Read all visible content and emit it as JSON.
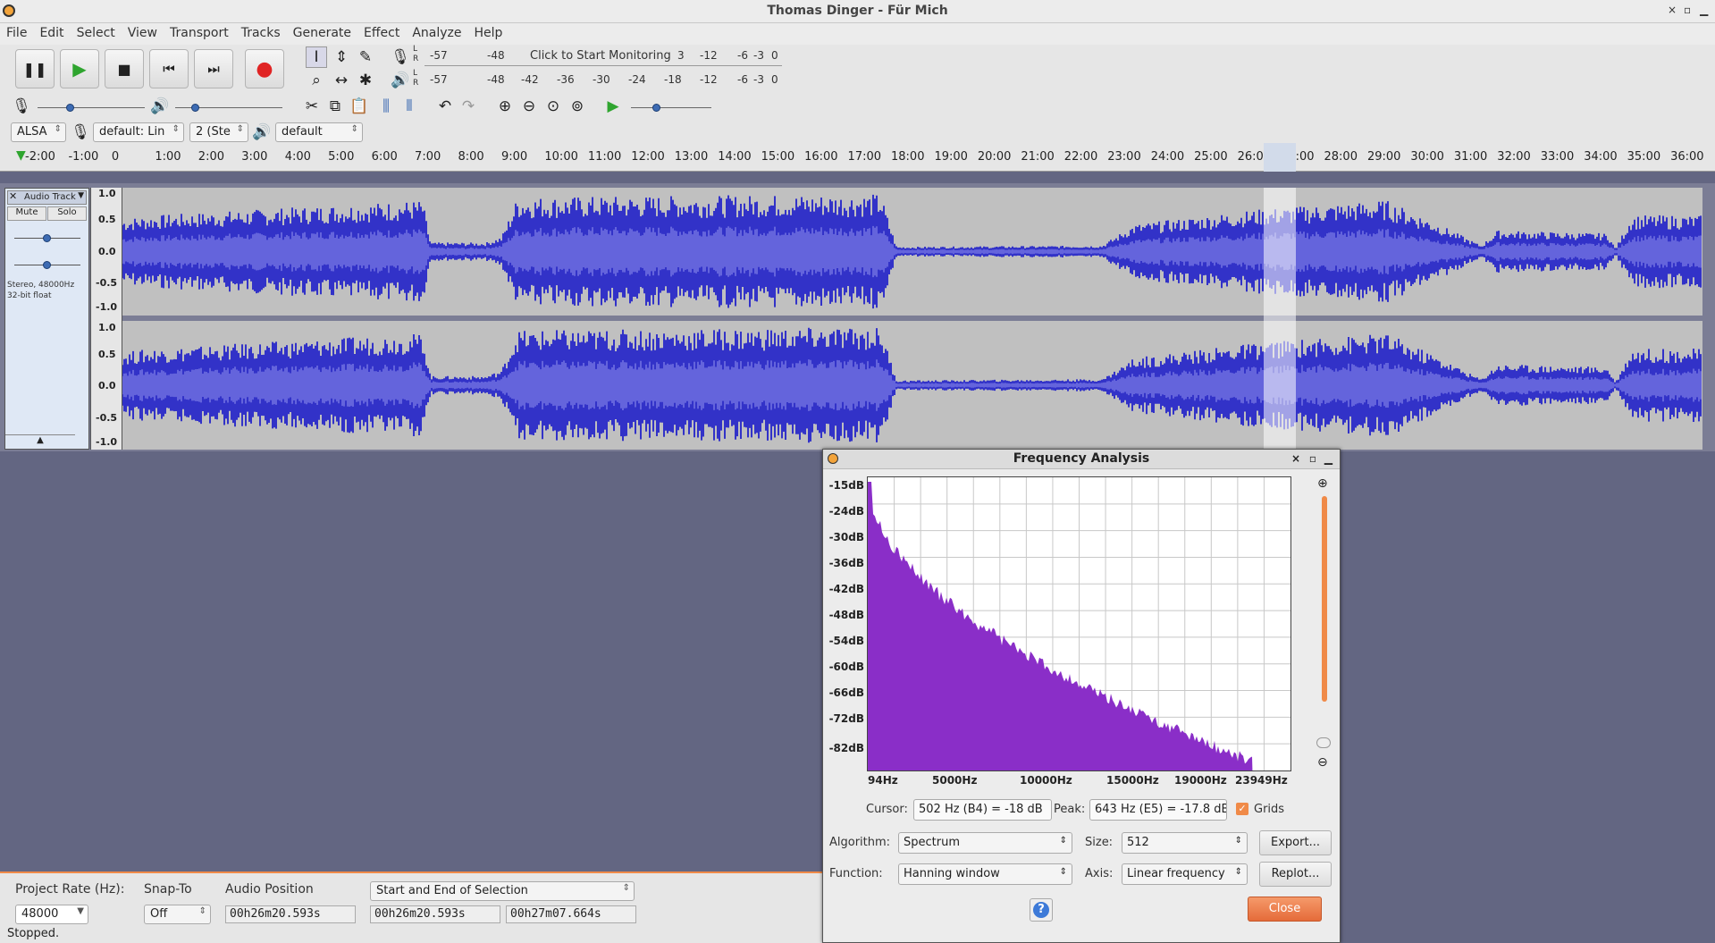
{
  "window": {
    "title": "Thomas Dinger - Für Mich"
  },
  "menu": [
    "File",
    "Edit",
    "Select",
    "View",
    "Transport",
    "Tracks",
    "Generate",
    "Effect",
    "Analyze",
    "Help"
  ],
  "meters": {
    "record_label": "L\nR",
    "record_scale": [
      "-57",
      "-48"
    ],
    "record_prompt": "Click to Start Monitoring",
    "record_scale_right": [
      "3",
      "-12",
      "-6",
      "-3",
      "0"
    ],
    "play_scale": [
      "-57",
      "-48",
      "-42",
      "-36",
      "-30",
      "-24",
      "-18",
      "-12",
      "-6",
      "-3",
      "0"
    ]
  },
  "device": {
    "host": "ALSA",
    "input": "default: Lin",
    "channels": "2 (Ste",
    "output": "default"
  },
  "timeline": {
    "ticks": [
      "-2:00",
      "-1:00",
      "0",
      "1:00",
      "2:00",
      "3:00",
      "4:00",
      "5:00",
      "6:00",
      "7:00",
      "8:00",
      "9:00",
      "10:00",
      "11:00",
      "12:00",
      "13:00",
      "14:00",
      "15:00",
      "16:00",
      "17:00",
      "18:00",
      "19:00",
      "20:00",
      "21:00",
      "22:00",
      "23:00",
      "24:00",
      "25:00",
      "26:00",
      "27:00",
      "28:00",
      "29:00",
      "30:00",
      "31:00",
      "32:00",
      "33:00",
      "34:00",
      "35:00",
      "36:00"
    ]
  },
  "track": {
    "name": "Audio Track",
    "mute": "Mute",
    "solo": "Solo",
    "info_line1": "Stereo, 48000Hz",
    "info_line2": "32-bit float",
    "scale": [
      "1.0",
      "0.5",
      "0.0",
      "-0.5",
      "-1.0"
    ],
    "wave_color": "#3232c8",
    "wave_rms_color": "#6464dc"
  },
  "freq": {
    "title": "Frequency Analysis",
    "db_labels": [
      "-15dB",
      "-24dB",
      "-30dB",
      "-36dB",
      "-42dB",
      "-48dB",
      "-54dB",
      "-60dB",
      "-66dB",
      "-72dB",
      "-82dB"
    ],
    "hz_labels": [
      "94Hz",
      "5000Hz",
      "10000Hz",
      "15000Hz",
      "19000Hz",
      "23949Hz"
    ],
    "cursor_label": "Cursor:",
    "cursor_value": "502 Hz (B4) = -18 dB",
    "peak_label": "Peak:",
    "peak_value": "643 Hz (E5) = -17.8 dB",
    "grids_label": "Grids",
    "algorithm_label": "Algorithm:",
    "algorithm_value": "Spectrum",
    "size_label": "Size:",
    "size_value": "512",
    "export_label": "Export...",
    "function_label": "Function:",
    "function_value": "Hanning window",
    "axis_label": "Axis:",
    "axis_value": "Linear frequency",
    "replot_label": "Replot...",
    "help_label": "?",
    "close_label": "Close",
    "spectrum_color": "#8a2ec8"
  },
  "selection": {
    "rate_label": "Project Rate (Hz):",
    "rate_value": "48000",
    "snap_label": "Snap-To",
    "snap_value": "Off",
    "audio_pos_label": "Audio Position",
    "audio_pos_value": "00h26m20.593s",
    "range_mode": "Start and End of Selection",
    "start_value": "00h26m20.593s",
    "end_value": "00h27m07.664s"
  },
  "status": "Stopped."
}
